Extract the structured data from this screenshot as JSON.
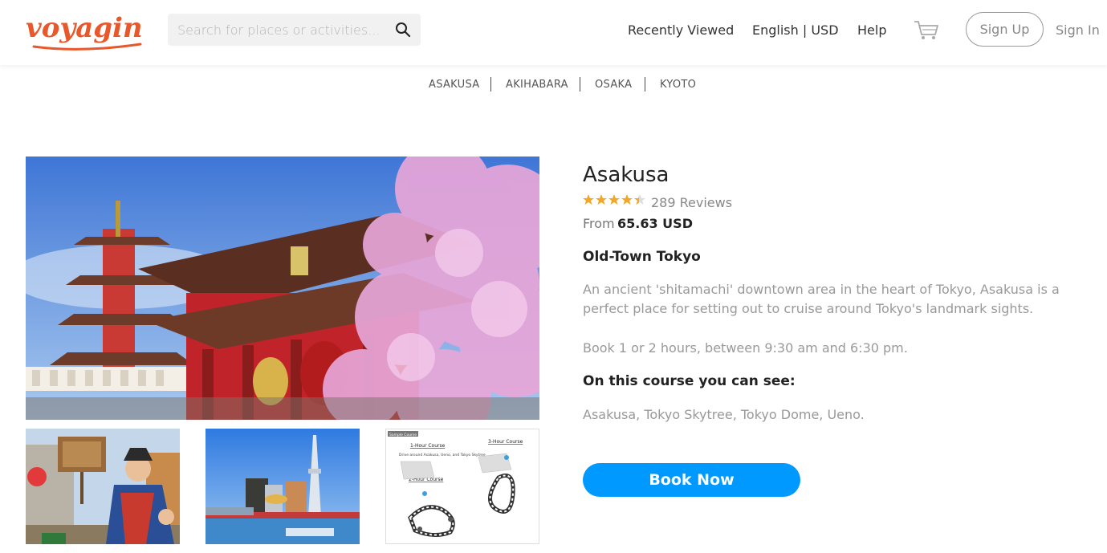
{
  "header": {
    "logo_text": "voyagin",
    "search_placeholder": "Search for places or activities...",
    "nav": {
      "recently_viewed": "Recently Viewed",
      "language_currency": "English | USD",
      "help": "Help",
      "sign_up": "Sign Up",
      "sign_in": "Sign In"
    }
  },
  "subnav": {
    "items": [
      "ASAKUSA",
      "AKIHABARA",
      "OSAKA",
      "KYOTO"
    ]
  },
  "gallery": {
    "map_thumb": {
      "tag": "Sample Course",
      "one_hour_title": "1-Hour Course",
      "one_hour_desc": "Drive around Asakusa, Ueno, and Tokyo Skytree",
      "two_hour_title": "2-Hour Course",
      "three_hour_title": "3-Hour Course"
    }
  },
  "product": {
    "title": "Asakusa",
    "rating": 4.5,
    "rating_max": 5,
    "reviews": "289 Reviews",
    "price_prefix": "From",
    "price": "65.63 USD",
    "subtitle": "Old-Town Tokyo",
    "description": "An ancient 'shitamachi' downtown area in the heart of Tokyo, Asakusa is a perfect place for setting out to cruise around Tokyo's landmark sights.",
    "booking_info": "Book 1 or 2 hours, between 9:30 am and 6:30 pm.",
    "course_heading": "On this course you can see:",
    "course_sights": "Asakusa, Tokyo Skytree, Tokyo Dome, Ueno.",
    "book_button": "Book Now"
  },
  "colors": {
    "brand": "#e8582a",
    "book_button": "#0099ff",
    "star": "#f5a623"
  }
}
